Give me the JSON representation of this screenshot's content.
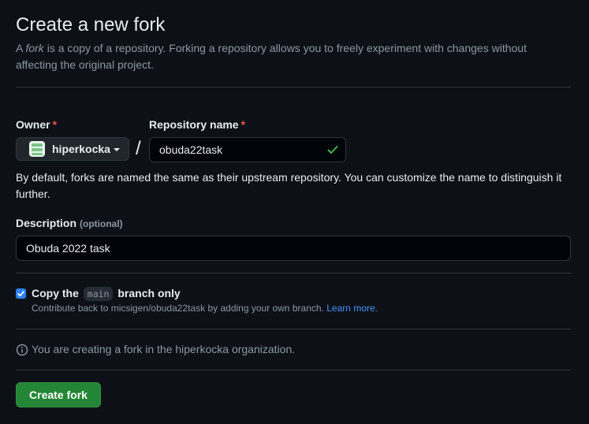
{
  "header": {
    "title": "Create a new fork",
    "intro_prefix": "A ",
    "intro_em": "fork",
    "intro_suffix": " is a copy of a repository. Forking a repository allows you to freely experiment with changes without affecting the original project."
  },
  "owner": {
    "label": "Owner",
    "required_mark": "*",
    "selected": "hiperkocka"
  },
  "separator": "/",
  "repository_name": {
    "label": "Repository name",
    "required_mark": "*",
    "value": "obuda22task",
    "valid": true
  },
  "naming_help": "By default, forks are named the same as their upstream repository. You can customize the name to distinguish it further.",
  "description": {
    "label": "Description",
    "optional_text": "(optional)",
    "value": "Obuda 2022 task"
  },
  "copy_branch": {
    "checked": true,
    "label_prefix": "Copy the",
    "branch": "main",
    "label_suffix": "branch only",
    "note": "Contribute back to micsigen/obuda22task by adding your own branch.",
    "learn_more": "Learn more."
  },
  "info": {
    "icon": "info-icon",
    "text": "You are creating a fork in the hiperkocka organization."
  },
  "submit": {
    "label": "Create fork"
  },
  "colors": {
    "background": "#0d1117",
    "primary_button": "#238636",
    "checkbox": "#2f81f7",
    "link": "#4493f8",
    "required": "#f85149",
    "valid_check": "#3fb950"
  }
}
